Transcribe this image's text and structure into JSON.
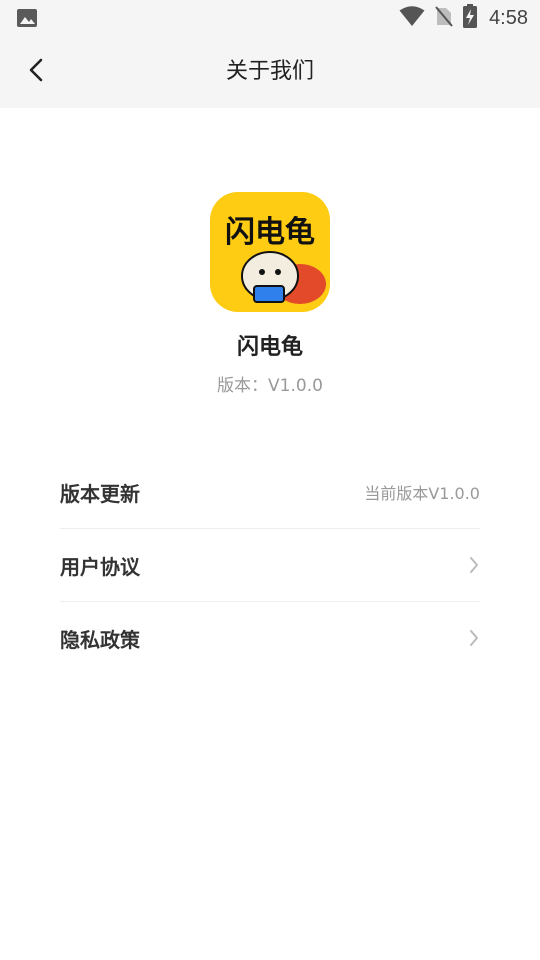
{
  "status_bar": {
    "time": "4:58",
    "icons": [
      "image-icon",
      "wifi-icon",
      "no-sim-icon",
      "battery-charging-icon"
    ]
  },
  "header": {
    "title": "关于我们",
    "back_icon": "chevron-left-icon"
  },
  "app": {
    "logo_text": "闪电龟",
    "name": "闪电龟",
    "version": "版本：V1.0.0",
    "logo_color": "#ffcc14"
  },
  "settings": {
    "items": [
      {
        "label": "版本更新",
        "value": "当前版本V1.0.0"
      },
      {
        "label": "用户协议",
        "icon": "chevron-right-icon"
      },
      {
        "label": "隐私政策",
        "icon": "chevron-right-icon"
      }
    ]
  }
}
